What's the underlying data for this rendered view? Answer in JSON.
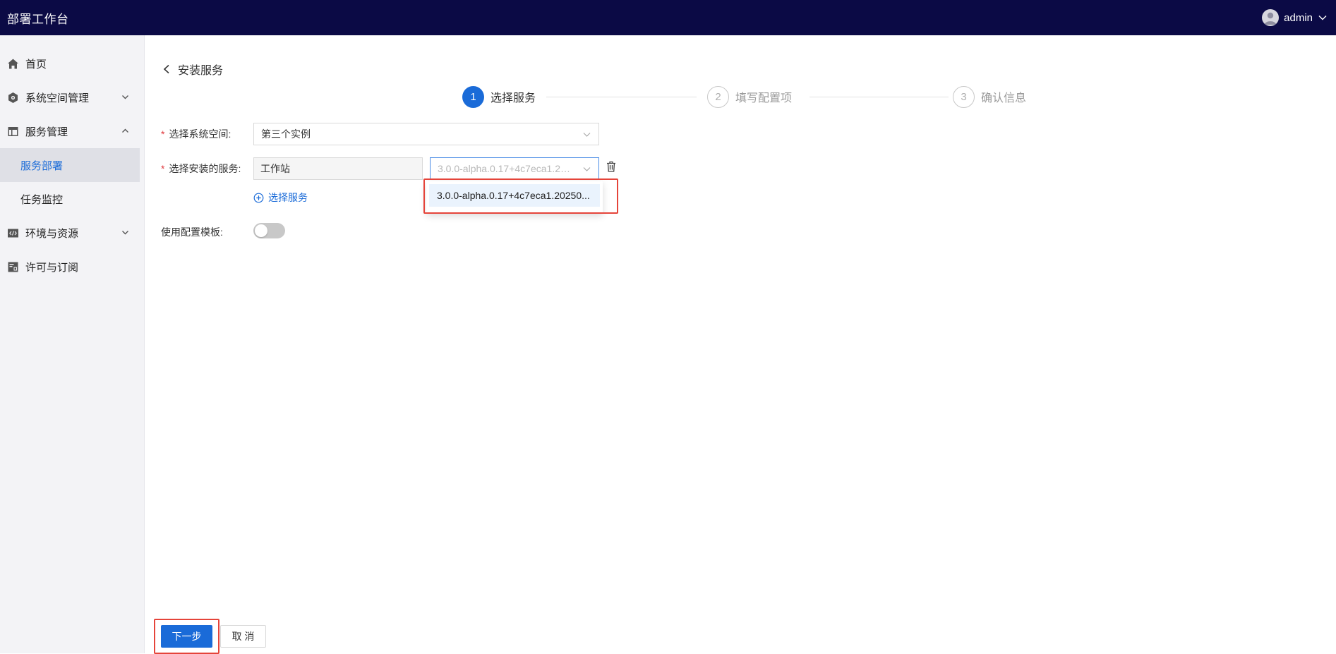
{
  "header": {
    "title": "部署工作台",
    "user_name": "admin"
  },
  "sidebar": {
    "items": [
      {
        "label": "首页",
        "icon": "home-icon"
      },
      {
        "label": "系统空间管理",
        "icon": "hexagon-gear-icon"
      },
      {
        "label": "服务管理",
        "icon": "layout-icon"
      },
      {
        "label": "环境与资源",
        "icon": "code-icon"
      },
      {
        "label": "许可与订阅",
        "icon": "license-icon"
      }
    ],
    "sub_items": [
      {
        "label": "服务部署",
        "active": true
      },
      {
        "label": "任务监控",
        "active": false
      }
    ]
  },
  "page": {
    "back_title": "安装服务"
  },
  "steps": [
    {
      "number": "1",
      "label": "选择服务",
      "state": "active"
    },
    {
      "number": "2",
      "label": "填写配置项",
      "state": "todo"
    },
    {
      "number": "3",
      "label": "确认信息",
      "state": "todo"
    }
  ],
  "form": {
    "space_label": "选择系统空间:",
    "space_value": "第三个实例",
    "service_label": "选择安装的服务:",
    "service_name": "工作站",
    "version_placeholder": "3.0.0-alpha.0.17+4c7eca1.202...",
    "add_service_label": "选择服务",
    "template_label": "使用配置模板:",
    "template_enabled": false
  },
  "dropdown": {
    "options": [
      "3.0.0-alpha.0.17+4c7eca1.20250..."
    ]
  },
  "footer": {
    "next_label": "下一步",
    "cancel_label": "取 消"
  },
  "colors": {
    "header_bg": "#0b0a45",
    "primary": "#1a6bd8",
    "highlight": "#e5443a"
  }
}
